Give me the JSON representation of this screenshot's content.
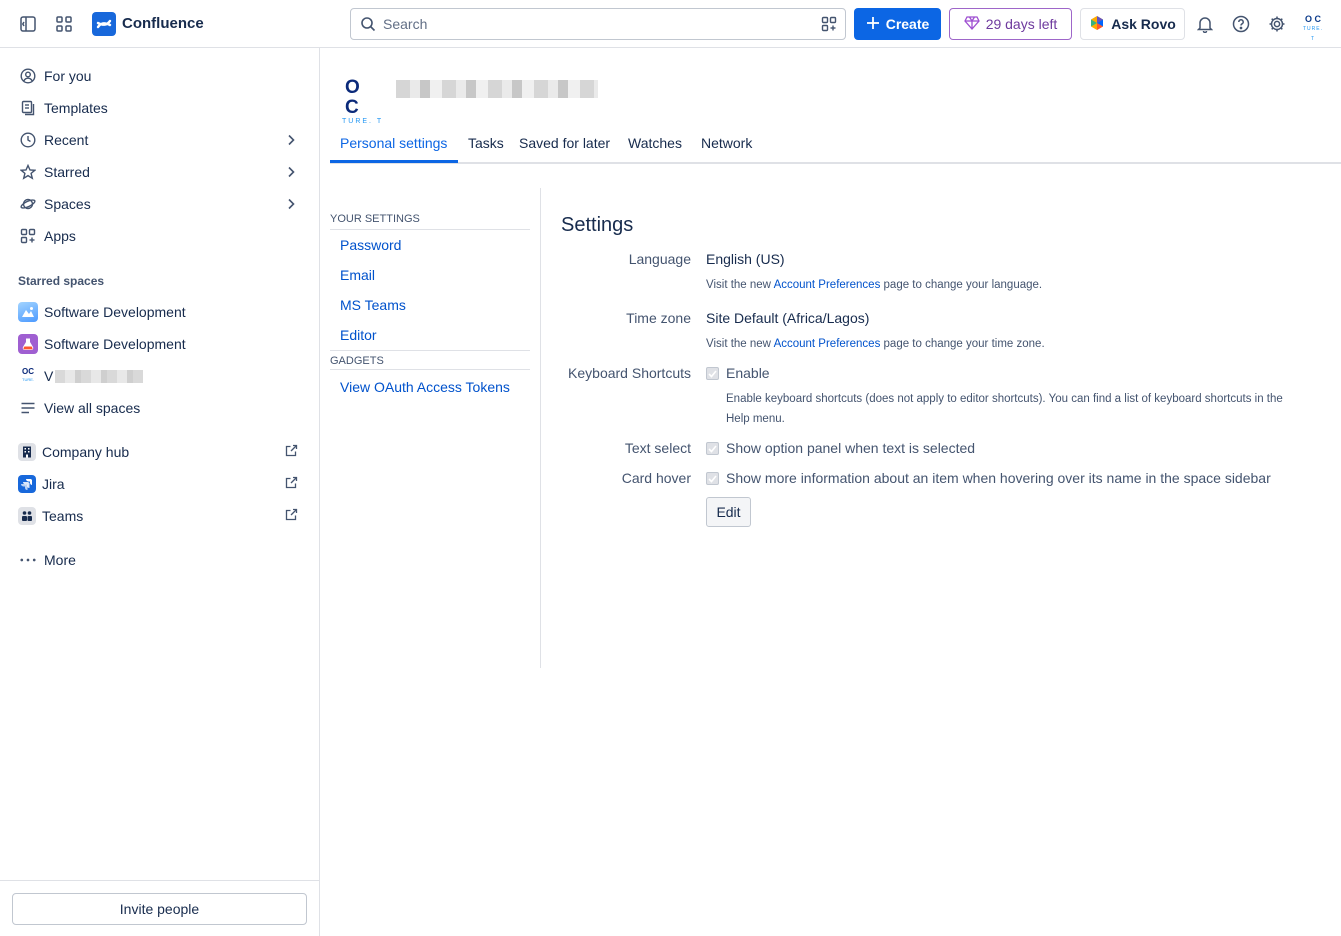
{
  "topbar": {
    "app_name": "Confluence",
    "search_placeholder": "Search",
    "create_label": "Create",
    "trial_label": "29 days left",
    "rovo_label": "Ask Rovo",
    "avatar_text": "O C",
    "avatar_sub": "TURE. T"
  },
  "sidebar": {
    "items": [
      {
        "label": "For you",
        "icon": "person-circle-icon"
      },
      {
        "label": "Templates",
        "icon": "templates-icon"
      },
      {
        "label": "Recent",
        "icon": "clock-icon"
      },
      {
        "label": "Starred",
        "icon": "star-icon"
      },
      {
        "label": "Spaces",
        "icon": "planet-icon"
      },
      {
        "label": "Apps",
        "icon": "apps-icon"
      }
    ],
    "starred_title": "Starred spaces",
    "starred_spaces": [
      {
        "label": "Software Development"
      },
      {
        "label": "Software Development"
      },
      {
        "label": "V"
      }
    ],
    "view_all": "View all spaces",
    "links": [
      {
        "label": "Company hub"
      },
      {
        "label": "Jira"
      },
      {
        "label": "Teams"
      }
    ],
    "more": "More",
    "invite": "Invite people"
  },
  "profile": {
    "logo_big": "O C",
    "logo_small": "TURE. T"
  },
  "tabs": [
    {
      "label": "Personal settings",
      "active": true
    },
    {
      "label": "Tasks"
    },
    {
      "label": "Saved for later"
    },
    {
      "label": "Watches"
    },
    {
      "label": "Network"
    }
  ],
  "settings_nav": {
    "your_settings": "YOUR SETTINGS",
    "links": [
      "Password",
      "Email",
      "MS Teams",
      "Editor"
    ],
    "gadgets": "GADGETS",
    "gadget_links": [
      "View OAuth Access Tokens"
    ]
  },
  "settings": {
    "title": "Settings",
    "language_label": "Language",
    "language_value": "English (US)",
    "hint_prefix": "Visit the new",
    "hint_link": "Account Preferences",
    "language_hint_suffix": "page to change your language.",
    "timezone_label": "Time zone",
    "timezone_value": "Site Default (Africa/Lagos)",
    "timezone_hint_suffix": "page to change your time zone.",
    "shortcuts_label": "Keyboard Shortcuts",
    "shortcuts_value": "Enable",
    "shortcuts_hint_1": "Enable keyboard shortcuts (does not apply to editor shortcuts). You can find a list of keyboard shortcuts in the",
    "shortcuts_hint_2": "Help menu.",
    "textselect_label": "Text select",
    "textselect_value": "Show option panel when text is selected",
    "cardhover_label": "Card hover",
    "cardhover_value": "Show more information about an item when hovering over its name in the space sidebar",
    "edit_label": "Edit"
  },
  "colors": {
    "brand": "#0c66e4",
    "link": "#0052cc",
    "trial": "#6e3a9e"
  }
}
